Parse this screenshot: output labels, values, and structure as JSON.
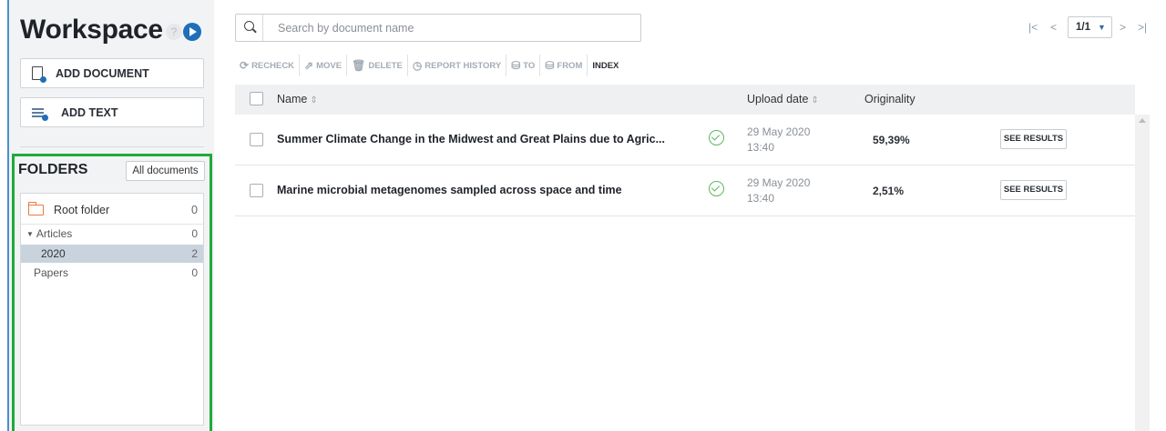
{
  "workspace": {
    "title": "Workspace",
    "help_icon": "?"
  },
  "sidebar": {
    "add_document": "ADD DOCUMENT",
    "add_text": "ADD TEXT",
    "folders_title": "FOLDERS",
    "all_documents": "All documents",
    "tree": [
      {
        "label": "Root folder",
        "count": "0"
      },
      {
        "label": "Articles",
        "count": "0",
        "expanded": true
      },
      {
        "label": "2020",
        "count": "2",
        "selected": true
      },
      {
        "label": "Papers",
        "count": "0"
      }
    ]
  },
  "search": {
    "placeholder": "Search by document name",
    "value": ""
  },
  "pagination": {
    "first": "|<",
    "prev": "<",
    "current": "1/1",
    "next": ">",
    "last": ">|"
  },
  "toolbar": {
    "recheck": "RECHECK",
    "move": "MOVE",
    "delete": "DELETE",
    "report_history": "REPORT HISTORY",
    "to": "TO",
    "from": "FROM",
    "index": "INDEX"
  },
  "table": {
    "headers": {
      "name": "Name",
      "upload_date": "Upload date",
      "originality": "Originality"
    },
    "rows": [
      {
        "name": "Summer Climate Change in the Midwest and Great Plains due to Agric...",
        "date": "29 May 2020",
        "time": "13:40",
        "originality": "59,39%",
        "action": "SEE RESULTS"
      },
      {
        "name": "Marine microbial metagenomes sampled across space and time",
        "date": "29 May 2020",
        "time": "13:40",
        "originality": "2,51%",
        "action": "SEE RESULTS"
      }
    ]
  },
  "colors": {
    "accent": "#1c6fb8",
    "highlight_border": "#1fab3a",
    "status_ok": "#5cb85c",
    "folder": "#e97a45"
  }
}
